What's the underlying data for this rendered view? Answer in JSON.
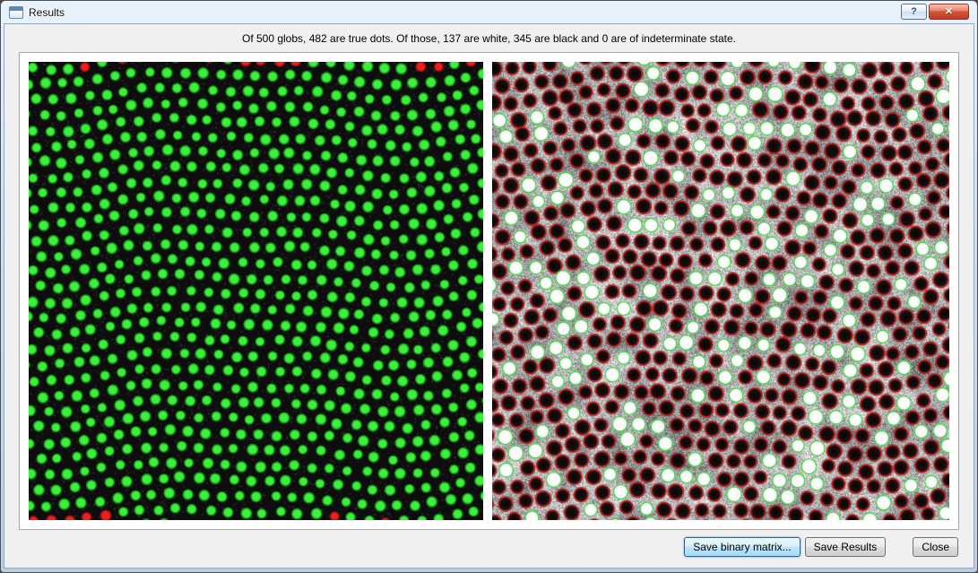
{
  "window": {
    "title": "Results",
    "help_glyph": "?",
    "close_glyph": "✕"
  },
  "summary": "Of 500 globs, 482 are true dots. Of those, 137 are white, 345 are black and 0 are of indeterminate state.",
  "stats": {
    "globs": 500,
    "true_dots": 482,
    "white": 137,
    "black": 345,
    "indeterminate": 0
  },
  "buttons": {
    "save_binary_matrix": "Save binary matrix...",
    "save_results": "Save Results",
    "close": "Close"
  },
  "colors": {
    "left_background": "#0d0d0d",
    "dot_green_core": "#3df03d",
    "dot_green_edge": "#17a017",
    "dot_red_core": "#ef2020",
    "dot_red_edge": "#9d0f0f",
    "ring_red": "#cf1d1d",
    "ring_green": "#2ecc2e"
  }
}
